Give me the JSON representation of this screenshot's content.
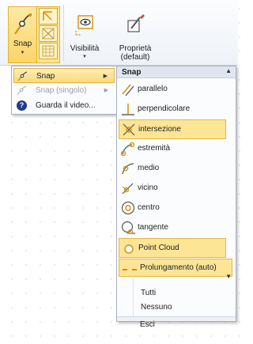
{
  "ribbon": {
    "snap_label": "Snap",
    "visibility_label": "Visibilità",
    "properties_label_line1": "Proprietà",
    "properties_label_line2": "(default)"
  },
  "menu": {
    "items": [
      {
        "label": "Snap",
        "icon": "snap-icon",
        "state": "active",
        "has_submenu": true
      },
      {
        "label": "Snap (singolo)",
        "icon": "snap-single-icon",
        "state": "disabled",
        "has_submenu": true
      },
      {
        "label": "Guarda il video...",
        "icon": "help-icon",
        "state": "normal",
        "has_submenu": false
      }
    ]
  },
  "submenu": {
    "title": "Snap",
    "items": [
      {
        "label": "parallelo",
        "icon": "parallel-icon",
        "checked": false
      },
      {
        "label": "perpendicolare",
        "icon": "perpendicular-icon",
        "checked": false
      },
      {
        "label": "intersezione",
        "icon": "intersection-icon",
        "checked": true
      },
      {
        "label": "estremità",
        "icon": "endpoint-icon",
        "checked": false
      },
      {
        "label": "medio",
        "icon": "midpoint-icon",
        "checked": false
      },
      {
        "label": "vicino",
        "icon": "nearest-icon",
        "checked": false
      },
      {
        "label": "centro",
        "icon": "center-icon",
        "checked": false
      },
      {
        "label": "tangente",
        "icon": "tangent-icon",
        "checked": false
      },
      {
        "label": "Point Cloud",
        "icon": "point-cloud-icon",
        "checked": true
      }
    ],
    "extension": {
      "label": "Prolungamento (auto)",
      "icon": "extension-icon",
      "checked": true
    },
    "actions": [
      "Tutti",
      "Nessuno",
      "Esci"
    ]
  },
  "colors": {
    "highlight": "#fde596",
    "highlight_border": "#e2b845",
    "icon_orange": "#d98b0c",
    "menu_header": "#dfe6ef"
  }
}
